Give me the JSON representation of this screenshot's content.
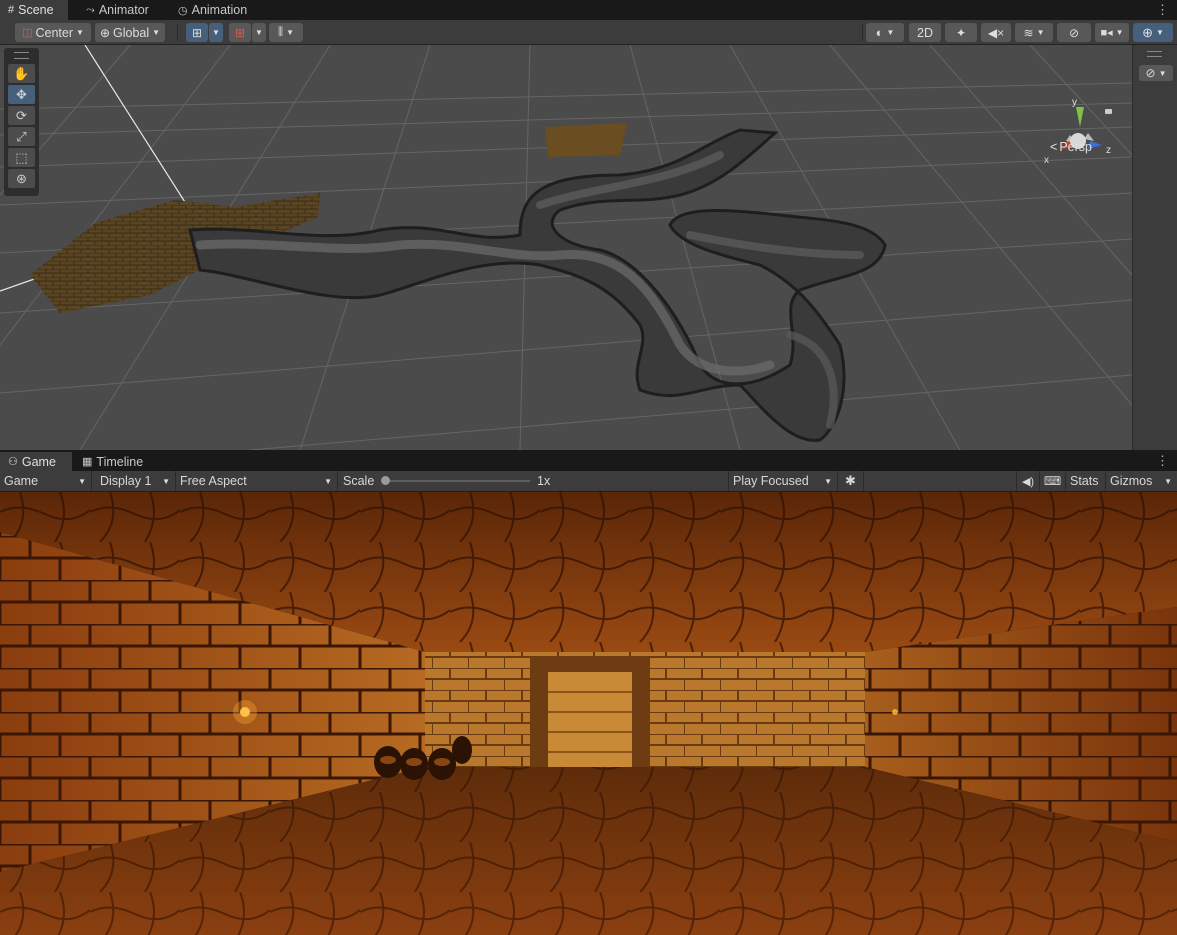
{
  "scene_tabs": [
    {
      "label": "Scene",
      "icon": "grid-icon",
      "active": true
    },
    {
      "label": "Animator",
      "icon": "animator-icon",
      "active": false
    },
    {
      "label": "Animation",
      "icon": "clock-icon",
      "active": false
    }
  ],
  "scene_toolbar": {
    "pivot_label": "Center",
    "space_label": "Global",
    "mode_2d": "2D"
  },
  "scene_view": {
    "projection_label": "Persp",
    "gizmo_axes": {
      "y": "y",
      "x": "x",
      "z": "z"
    }
  },
  "game_tabs": [
    {
      "label": "Game",
      "icon": "gamepad-icon",
      "active": true
    },
    {
      "label": "Timeline",
      "icon": "film-icon",
      "active": false
    }
  ],
  "game_toolbar": {
    "view_select": "Game",
    "display_select": "Display 1",
    "aspect_select": "Free Aspect",
    "scale_label": "Scale",
    "scale_value": "1x",
    "play_mode_select": "Play Focused",
    "stats_label": "Stats",
    "gizmos_label": "Gizmos"
  },
  "colors": {
    "panel": "#3c3c3c",
    "tab_bg": "#191919",
    "accent_blue": "#46607c",
    "grid_bg": "#4a4a4a"
  }
}
